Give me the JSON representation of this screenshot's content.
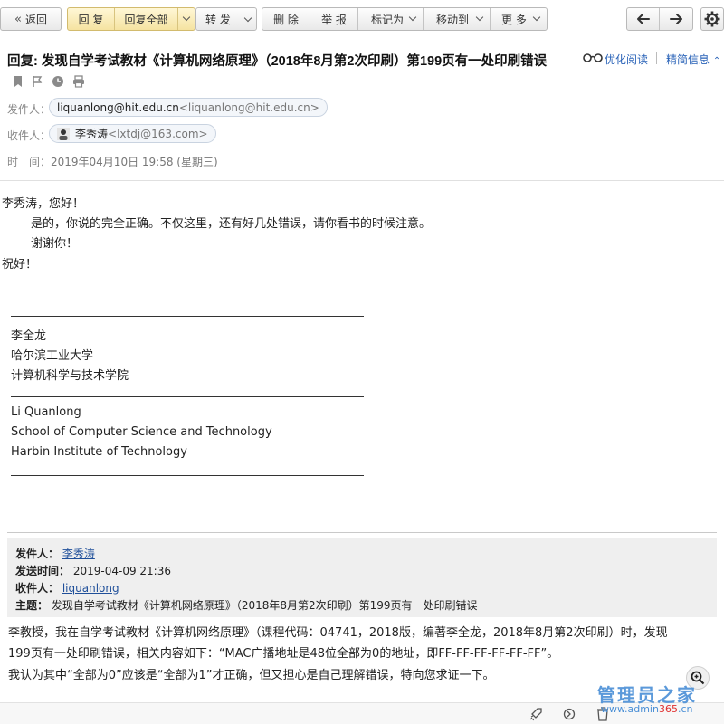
{
  "toolbar": {
    "back_label": "返回",
    "reply_label": "回 复",
    "reply_all_label": "回复全部",
    "forward_label": "转 发",
    "delete_label": "删 除",
    "report_label": "举 报",
    "mark_as_label": "标记为",
    "move_to_label": "移动到",
    "more_label": "更 多"
  },
  "email": {
    "subject": "回复: 发现自学考试教材《计算机网络原理》（2018年8月第2次印刷）第199页有一处印刷错误",
    "optimize_reading": "优化阅读",
    "brief_info": "精简信息",
    "from_label": "发件人：",
    "from_name": "liquanlong@hit.edu.cn",
    "from_addr": "<liquanlong@hit.edu.cn>",
    "to_label": "收件人：",
    "to_name": "李秀涛",
    "to_addr": "<lxtdj@163.com>",
    "time_label": "时　间：",
    "time_value": "2019年04月10日 19:58 (星期三)"
  },
  "body": {
    "greeting": "李秀涛，您好！",
    "line1": "是的，你说的完全正确。不仅这里，还有好几处错误，请你看书的时候注意。",
    "line2": "谢谢你！",
    "closing": "祝好！",
    "sig_cn_name": "李全龙",
    "sig_cn_univ": "哈尔滨工业大学",
    "sig_cn_school": "计算机科学与技术学院",
    "sig_en_name": "Li Quanlong",
    "sig_en_school": "School of Computer Science and Technology",
    "sig_en_univ": "Harbin Institute of Technology"
  },
  "quote": {
    "from_label": "发件人：",
    "from_value": "李秀涛",
    "sent_label": "发送时间：",
    "sent_value": "2019-04-09 21:36",
    "to_label": "收件人：",
    "to_value": "liquanlong",
    "subject_label": "主题：",
    "subject_value": "发现自学考试教材《计算机网络原理》（2018年8月第2次印刷）第199页有一处印刷错误"
  },
  "original": {
    "line1": "李教授，我在自学考试教材《计算机网络原理》（课程代码：04741，2018版，编著李全龙，2018年8月第2次印刷）时，发现",
    "line2": "199页有一处印刷错误，相关内容如下：“MAC广播地址是48位全部为0的地址，即FF-FF-FF-FF-FF-FF”。",
    "line3": "我认为其中“全部为0”应该是“全部为1”才正确，但又担心是自己理解错误，特向您求证一下。"
  },
  "watermark": {
    "title": "管理员之家",
    "url_prefix": "www.admin",
    "url_num": "365",
    "url_suffix": ".cn"
  },
  "colors": {
    "link": "#2a63b8",
    "reply_group_bg": "#f5e3a1",
    "quote_bg": "#efefef"
  }
}
